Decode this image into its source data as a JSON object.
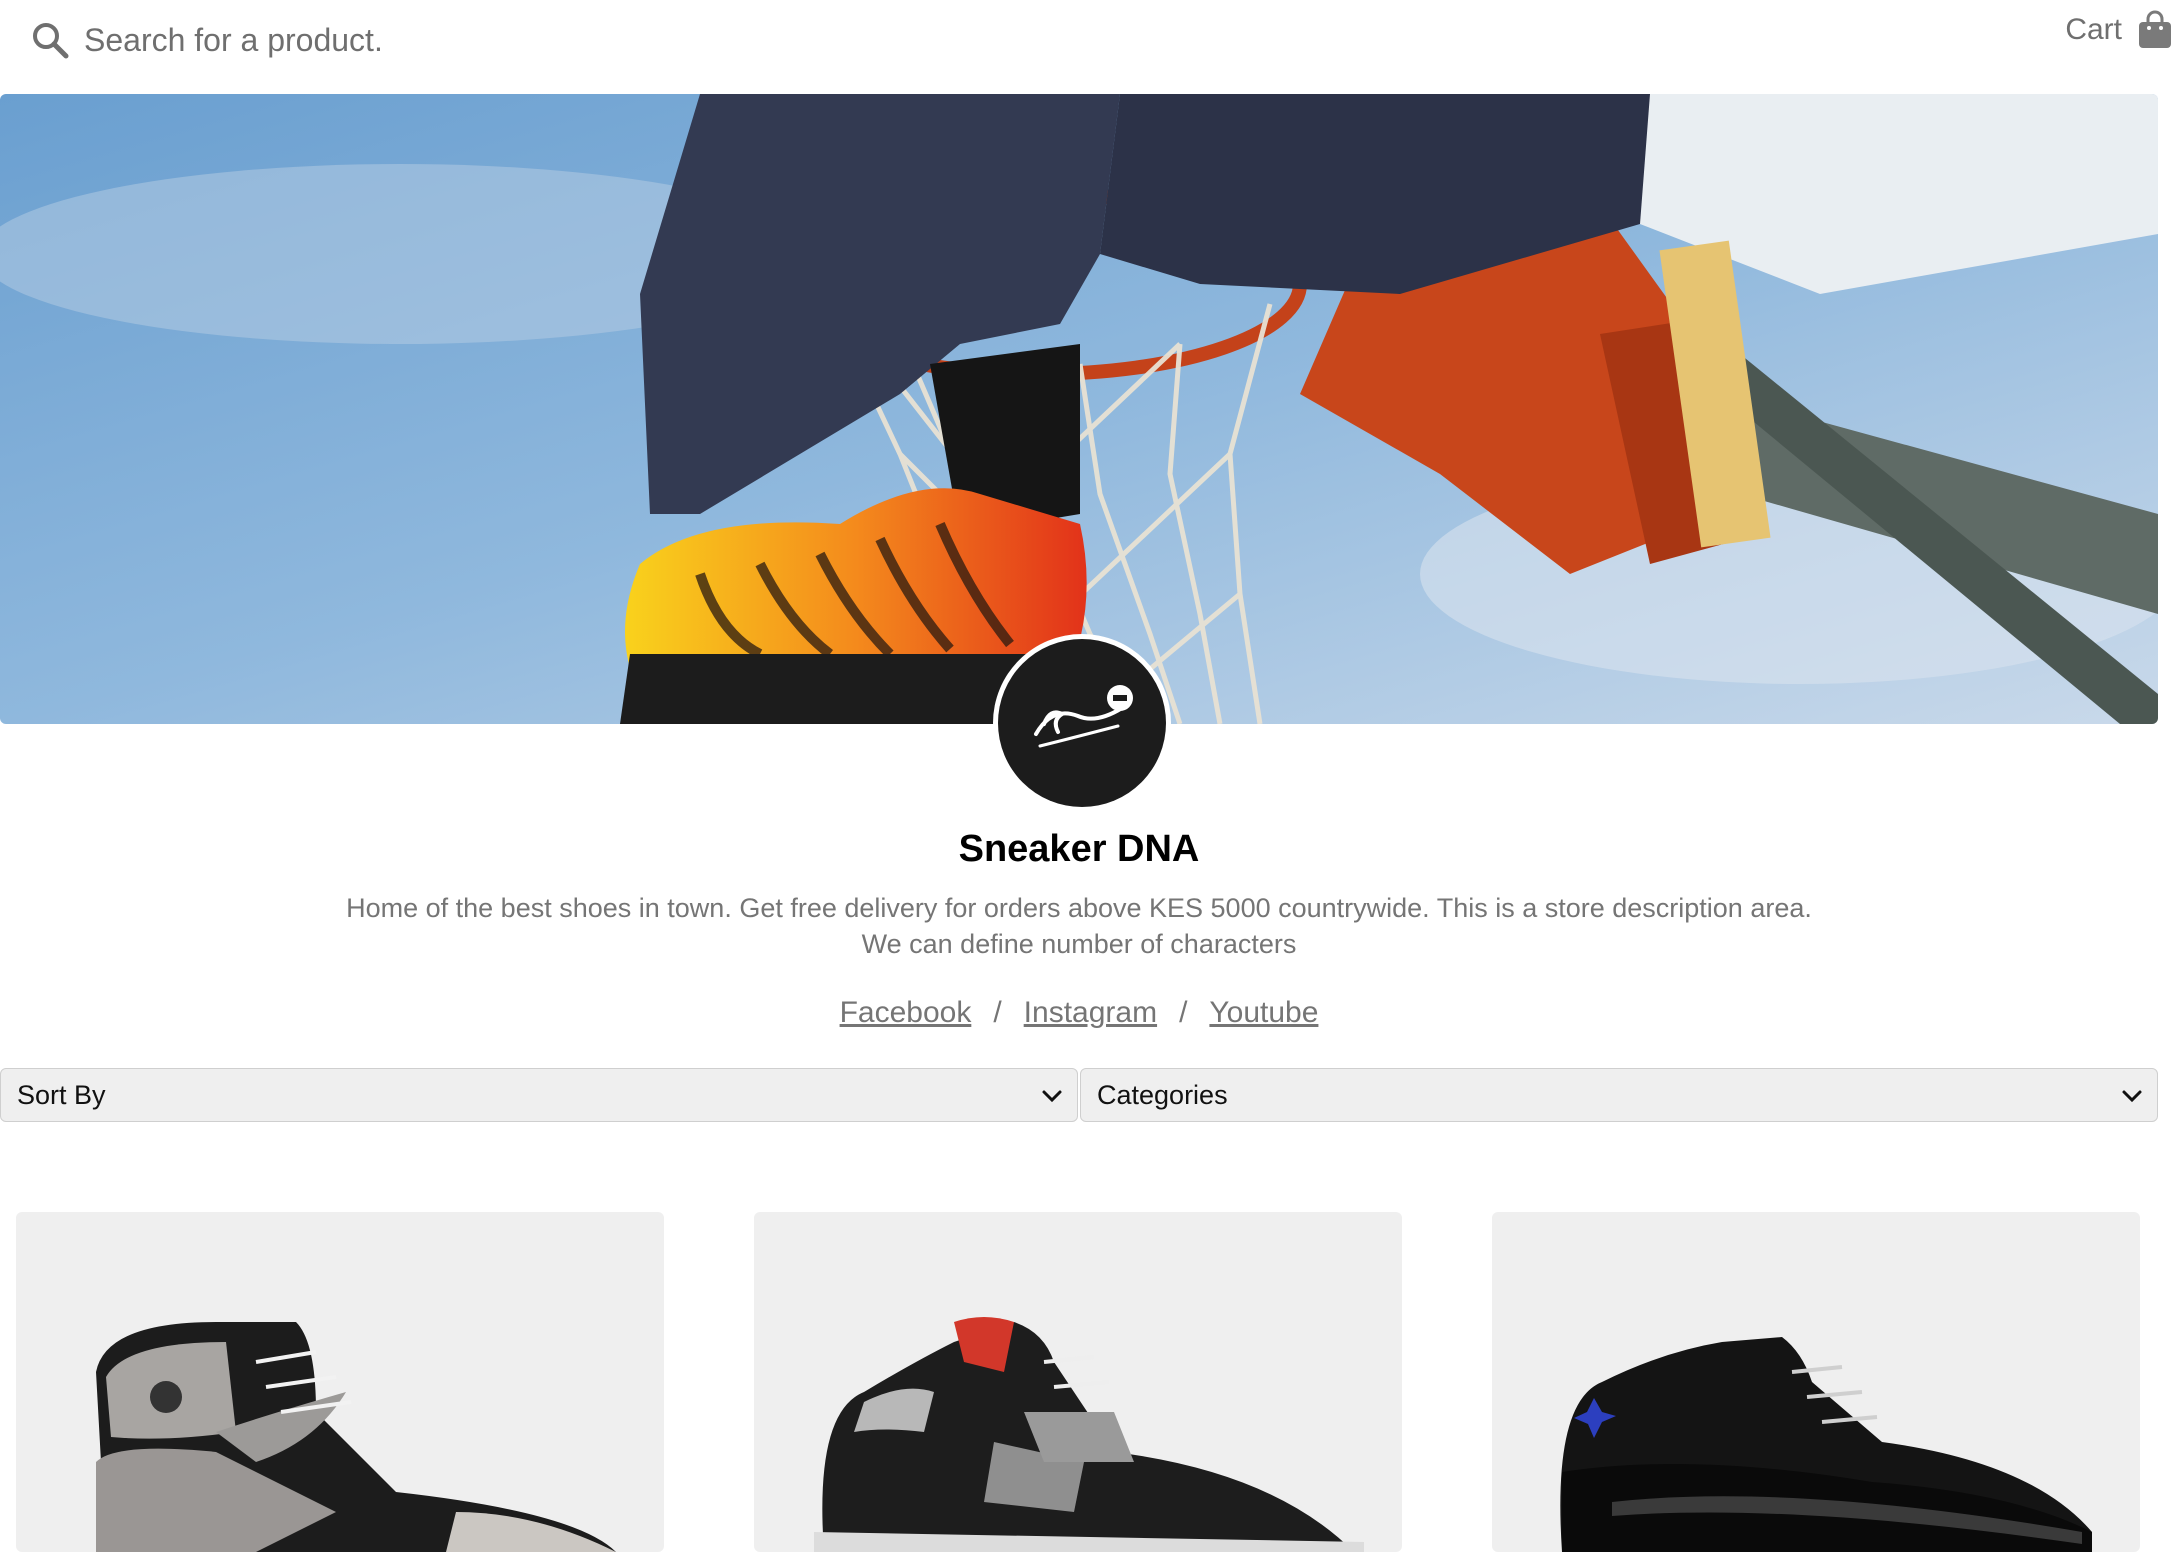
{
  "header": {
    "search_placeholder": "Search for a product.",
    "cart_label": "Cart"
  },
  "store": {
    "name": "Sneaker DNA",
    "logo_text": "Sneaker DNA",
    "description_line1": "Home of the best shoes in town. Get free delivery for orders above KES 5000 countrywide. This is a store description area.",
    "description_line2": "We can define number of characters"
  },
  "socials": {
    "items": [
      "Facebook",
      "Instagram",
      "Youtube"
    ],
    "separator": "/"
  },
  "filters": {
    "sort_by": "Sort By",
    "categories": "Categories"
  },
  "products": [
    {
      "image": "sneaker-high-top-grey-black-white"
    },
    {
      "image": "sneaker-black-grey-red"
    },
    {
      "image": "sneaker-black-patent-blue-logo"
    }
  ],
  "colors": {
    "sky": "#7fb0dc",
    "hoop_orange": "#d9541e",
    "shoe_orange": "#f07a1a",
    "logo_bg": "#1c1c1c",
    "muted_text": "#757575",
    "card_bg": "#efefef"
  }
}
